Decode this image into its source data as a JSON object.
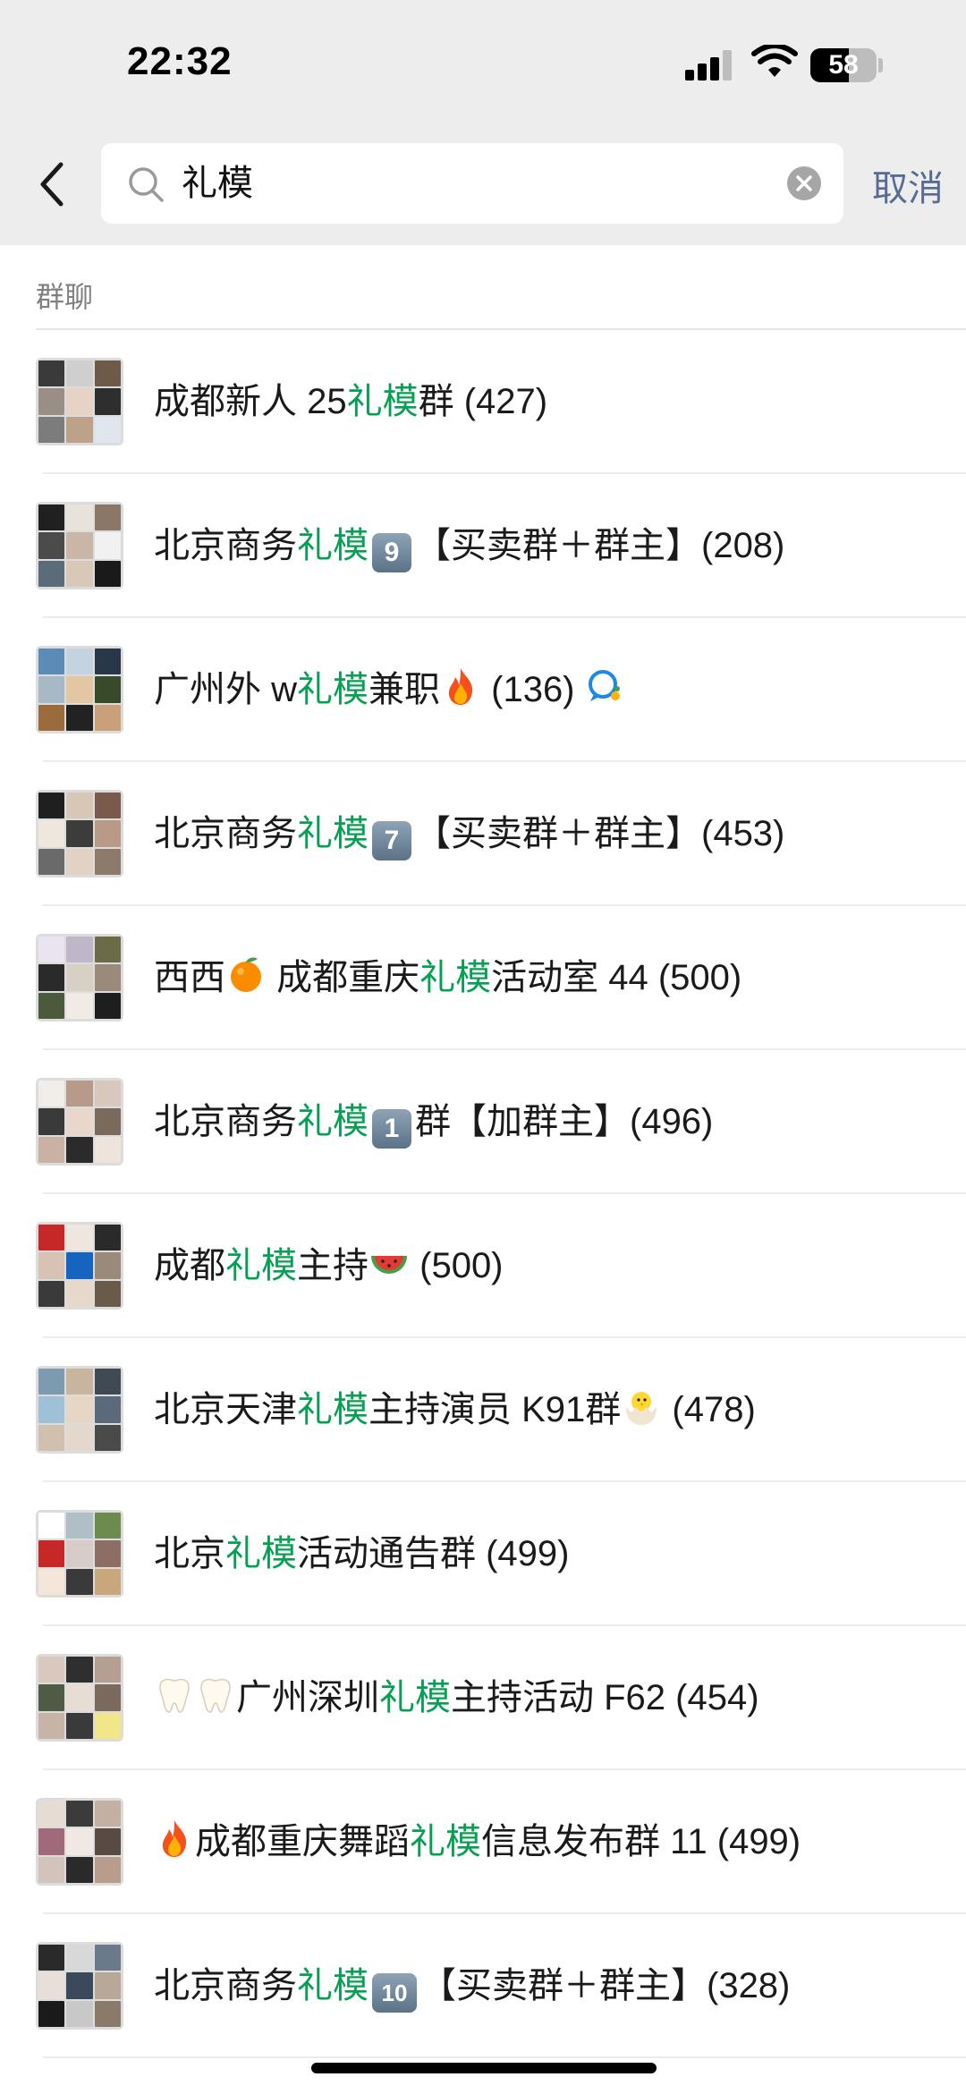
{
  "status_bar": {
    "time": "22:32",
    "battery": "58",
    "battery_level": 0.58
  },
  "search": {
    "query": "礼模",
    "cancel_label": "取消"
  },
  "section": {
    "title": "群聊"
  },
  "results": [
    {
      "parts": [
        "成都新人 25",
        "礼模",
        "群 (427)"
      ]
    },
    {
      "parts": [
        "北京商务",
        "礼模",
        "【买卖群＋群主】(208)"
      ],
      "keycap": "9"
    },
    {
      "parts": [
        "广州外 w",
        "礼模",
        "兼职"
      ],
      "suffix": "(136)",
      "emoji": "fire-emoji-icon",
      "trail_icon": "chat-bubble-icon"
    },
    {
      "parts": [
        "北京商务",
        "礼模",
        "【买卖群＋群主】(453)"
      ],
      "keycap": "7"
    },
    {
      "prefix": "西西",
      "prefix_emoji": "tangerine-emoji-icon",
      "parts": [
        "成都重庆",
        "礼模",
        "活动室 44 (500)"
      ]
    },
    {
      "parts": [
        "北京商务",
        "礼模",
        "群【加群主】(496)"
      ],
      "keycap": "1"
    },
    {
      "parts": [
        "成都",
        "礼模",
        "主持"
      ],
      "suffix": "(500)",
      "emoji": "watermelon-emoji-icon"
    },
    {
      "parts": [
        "北京天津",
        "礼模",
        "主持演员 K91群"
      ],
      "suffix": "(478)",
      "emoji": "hatching-chick-emoji-icon"
    },
    {
      "parts": [
        "北京",
        "礼模",
        "活动通告群 (499)"
      ]
    },
    {
      "lead_emoji": [
        "tooth-emoji-icon",
        "tooth-emoji-icon"
      ],
      "parts": [
        "广州深圳",
        "礼模",
        "主持活动 F62 (454)"
      ]
    },
    {
      "lead_emoji": [
        "fire-emoji-icon"
      ],
      "parts": [
        "成都重庆舞蹈",
        "礼模",
        "信息发布群 11 (499)"
      ]
    },
    {
      "parts": [
        "北京商务",
        "礼模",
        "【买卖群＋群主】(328)"
      ],
      "keycap": "10"
    }
  ],
  "colors": {
    "highlight": "#07a052",
    "cancel": "#576b95",
    "top_bar": "#ededed"
  },
  "icons": [
    "back-chevron-icon",
    "search-icon",
    "clear-icon"
  ]
}
